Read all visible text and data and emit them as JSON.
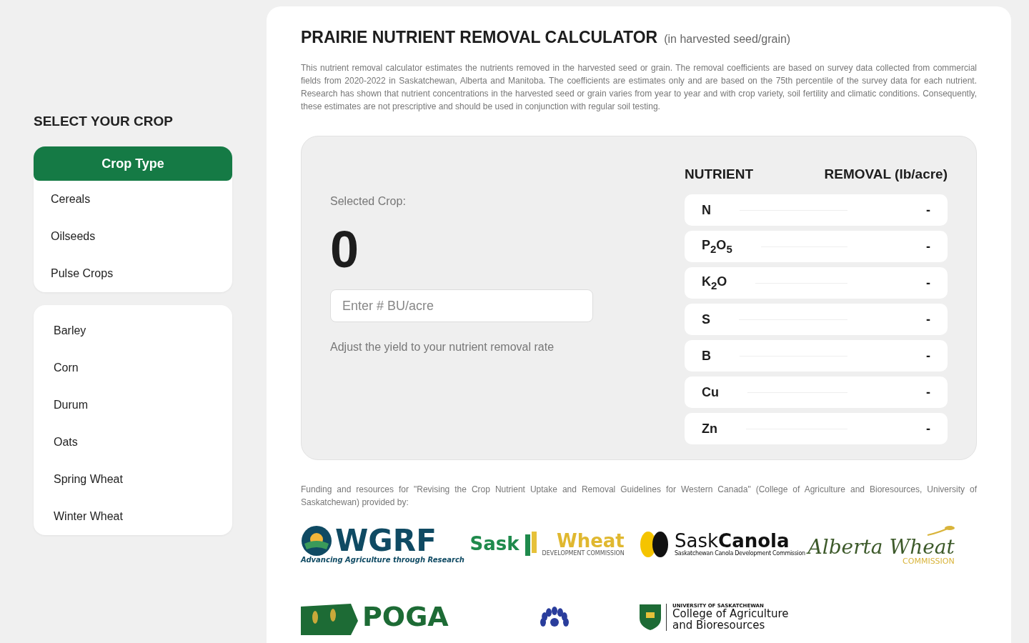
{
  "sidebar": {
    "title": "SELECT YOUR CROP",
    "categories": {
      "header": "Crop Type",
      "items": [
        {
          "label": "Cereals"
        },
        {
          "label": "Oilseeds"
        },
        {
          "label": "Pulse Crops"
        }
      ]
    },
    "crops": [
      {
        "label": "Barley"
      },
      {
        "label": "Corn"
      },
      {
        "label": "Durum"
      },
      {
        "label": "Oats"
      },
      {
        "label": "Spring Wheat"
      },
      {
        "label": "Winter Wheat"
      }
    ]
  },
  "main": {
    "title": "PRAIRIE NUTRIENT REMOVAL CALCULATOR",
    "subtitle": "(in harvested seed/grain)",
    "description": "This nutrient removal calculator estimates the nutrients removed in the harvested seed or grain. The removal coefficients are based on survey data collected from commercial fields from 2020-2022 in Saskatchewan, Alberta and Manitoba. The coefficients are estimates only and are based on the 75th percentile of the survey data for each nutrient. Research has shown that nutrient concentrations in the harvested seed or grain varies from year to year and with crop variety, soil fertility and climatic conditions. Consequently, these estimates are not prescriptive and should be used in conjunction with regular soil testing.",
    "calculator": {
      "selected_label": "Selected Crop:",
      "selected_value": "0",
      "yield_placeholder": "Enter # BU/acre",
      "hint": "Adjust the yield to your nutrient removal rate",
      "columns": [
        "NUTRIENT",
        "REMOVAL (lb/acre)"
      ],
      "rows": [
        {
          "nutrient": "N",
          "removal": "-"
        },
        {
          "nutrient": "P$_{2}$O$_{5}$",
          "removal": "-"
        },
        {
          "nutrient": "K$_{2}$O",
          "removal": "-"
        },
        {
          "nutrient": "S",
          "removal": "-"
        },
        {
          "nutrient": "B",
          "removal": "-"
        },
        {
          "nutrient": "Cu",
          "removal": "-"
        },
        {
          "nutrient": "Zn",
          "removal": "-"
        }
      ]
    },
    "funding_note": "Funding and resources for \"Revising the Crop Nutrient Uptake and Removal Guidelines for Western Canada\" (College of Agriculture and Bioresources, University of Saskatchewan) provided by:",
    "sponsors": [
      {
        "kind": "wgrf",
        "texts": [
          "WGRF",
          "Advancing Agriculture through Research"
        ]
      },
      {
        "kind": "saskwheat",
        "texts": [
          "Sask",
          "Wheat",
          "DEVELOPMENT COMMISSION"
        ]
      },
      {
        "kind": "saskcanola",
        "texts": [
          "Sask",
          "Canola",
          "Saskatchewan Canola Development Commission"
        ]
      },
      {
        "kind": "albertawheat",
        "texts": [
          "Alberta Wheat",
          "COMMISSION"
        ]
      },
      {
        "kind": "poga",
        "texts": [
          "POGA"
        ]
      },
      {
        "kind": "flower"
      },
      {
        "kind": "usask",
        "texts": [
          "UNIVERSITY OF SASKATCHEWAN",
          "College of Agriculture",
          "and Bioresources"
        ]
      }
    ]
  }
}
